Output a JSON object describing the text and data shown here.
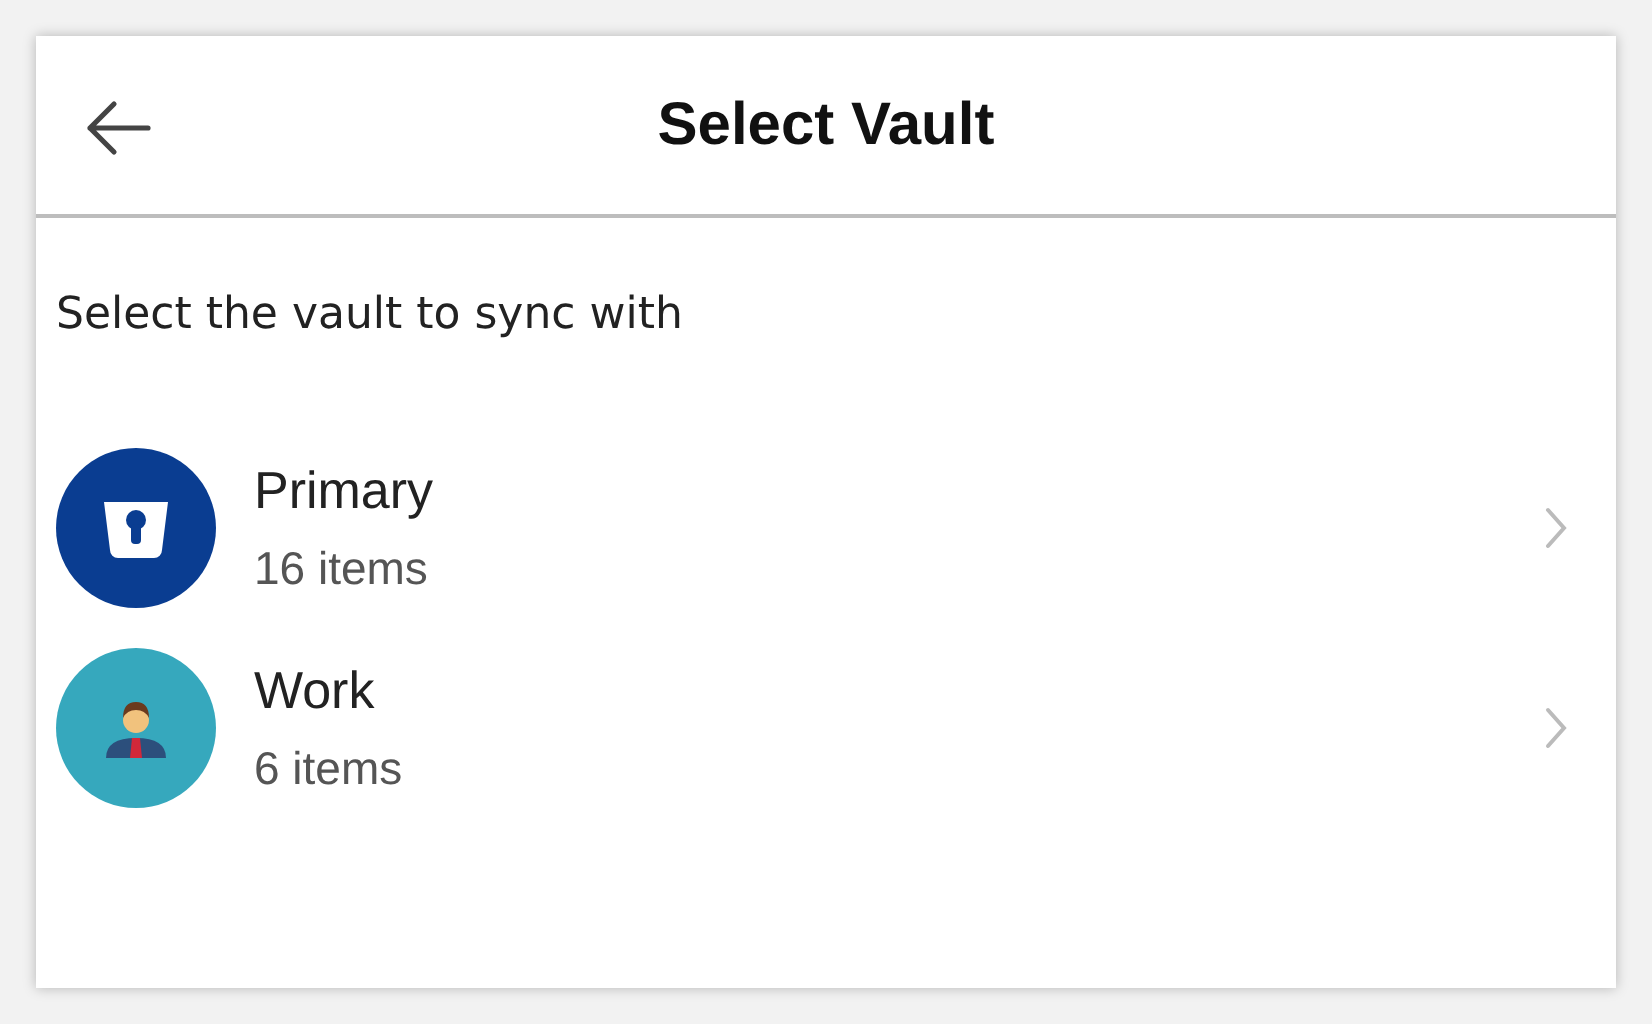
{
  "header": {
    "title": "Select Vault"
  },
  "prompt": "Select the vault to sync with",
  "vaults": [
    {
      "kind": "primary",
      "name": "Primary",
      "count": "16 items"
    },
    {
      "kind": "work",
      "name": "Work",
      "count": "6 items"
    }
  ]
}
